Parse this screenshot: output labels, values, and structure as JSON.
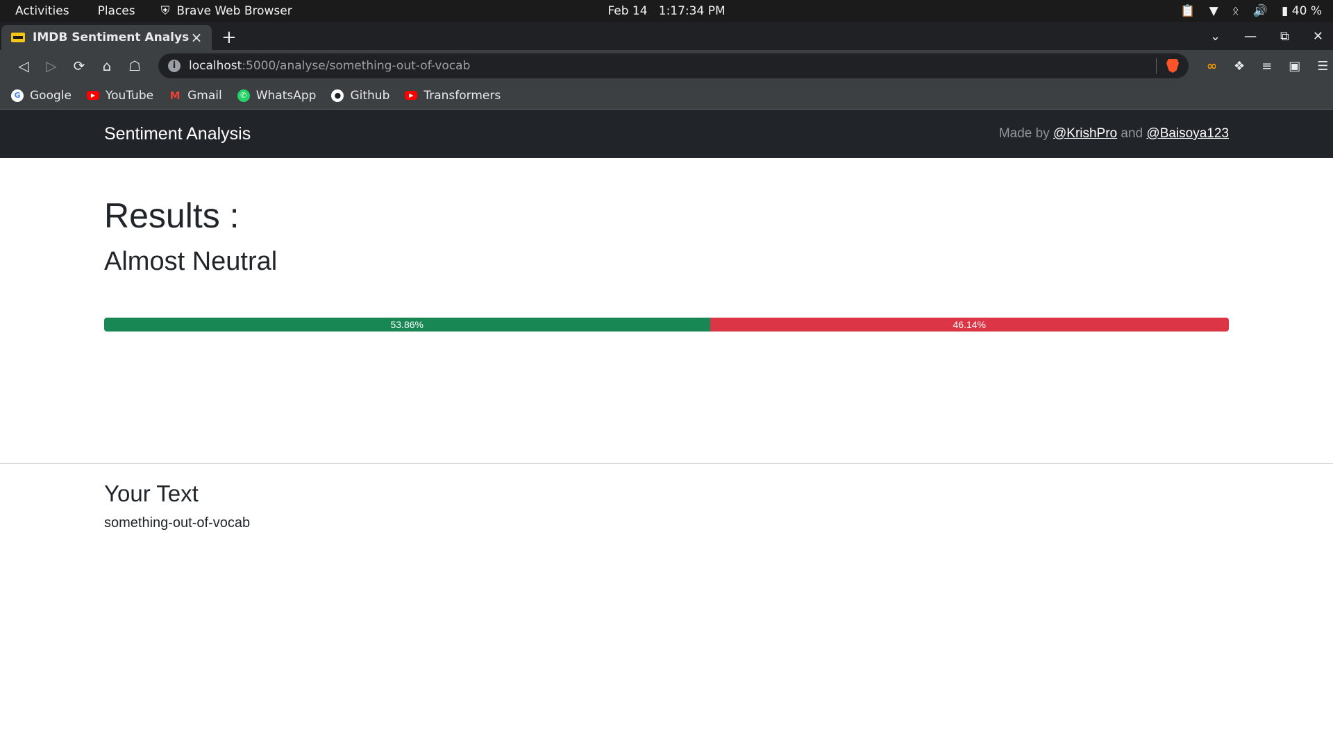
{
  "system_bar": {
    "activities": "Activities",
    "places": "Places",
    "app_name": "Brave Web Browser",
    "date": "Feb 14",
    "time": "1:17:34 PM",
    "battery": "40 %"
  },
  "browser": {
    "tab_title": "IMDB Sentiment Analysis",
    "url_host": "localhost",
    "url_path": ":5000/analyse/something-out-of-vocab",
    "bookmarks": [
      "Google",
      "YouTube",
      "Gmail",
      "WhatsApp",
      "Github",
      "Transformers"
    ]
  },
  "page": {
    "brand": "Sentiment Analysis",
    "made_by_prefix": "Made by",
    "author1": "@KrishPro",
    "and_text": "and",
    "author2": "@Baisoya123",
    "results_title": "Results :",
    "verdict": "Almost Neutral",
    "positive": {
      "value": 53.86,
      "label": "53.86%",
      "color": "#198754"
    },
    "negative": {
      "value": 46.14,
      "label": "46.14%",
      "color": "#dc3545"
    },
    "your_text_title": "Your Text",
    "your_text": "something-out-of-vocab"
  }
}
